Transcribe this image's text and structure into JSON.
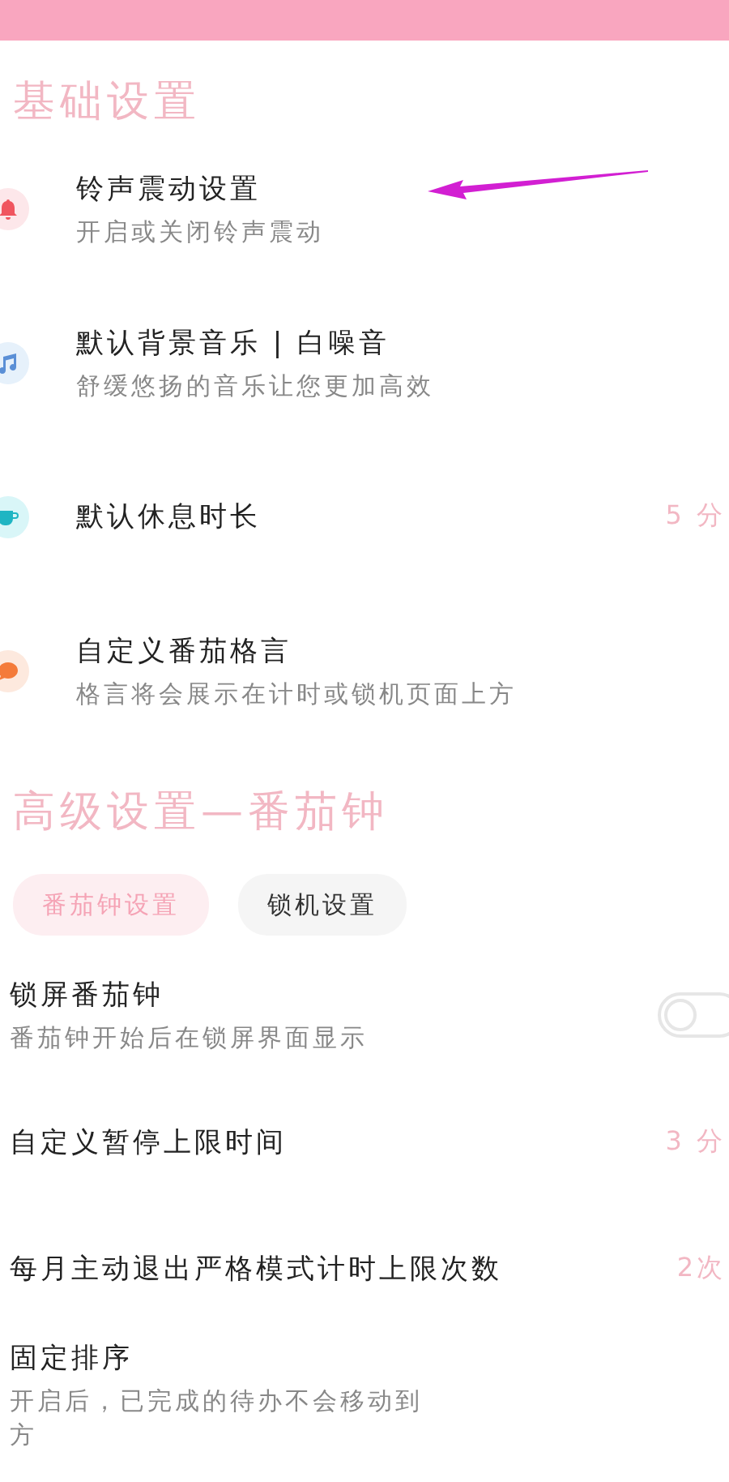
{
  "basic_section": {
    "title": "基础设置",
    "items": [
      {
        "title": "铃声震动设置",
        "subtitle": "开启或关闭铃声震动"
      },
      {
        "title": "默认背景音乐 | 白噪音",
        "subtitle": "舒缓悠扬的音乐让您更加高效"
      },
      {
        "title": "默认休息时长",
        "value": "5 分"
      },
      {
        "title": "自定义番茄格言",
        "subtitle": "格言将会展示在计时或锁机页面上方"
      }
    ]
  },
  "advanced_section": {
    "title": "高级设置—番茄钟",
    "tabs": [
      {
        "label": "番茄钟设置",
        "selected": true
      },
      {
        "label": "锁机设置",
        "selected": false
      }
    ],
    "items": [
      {
        "kind": "toggle",
        "title": "锁屏番茄钟",
        "subtitle": "番茄钟开始后在锁屏界面显示",
        "on": false
      },
      {
        "kind": "value",
        "title": "自定义暂停上限时间",
        "value": "3 分"
      },
      {
        "kind": "value",
        "title": "每月主动退出严格模式计时上限次数",
        "value": "2次"
      },
      {
        "kind": "lines",
        "title": "固定排序",
        "lines": [
          "开启后，已完成的待办不会移动到",
          "方"
        ]
      }
    ]
  }
}
